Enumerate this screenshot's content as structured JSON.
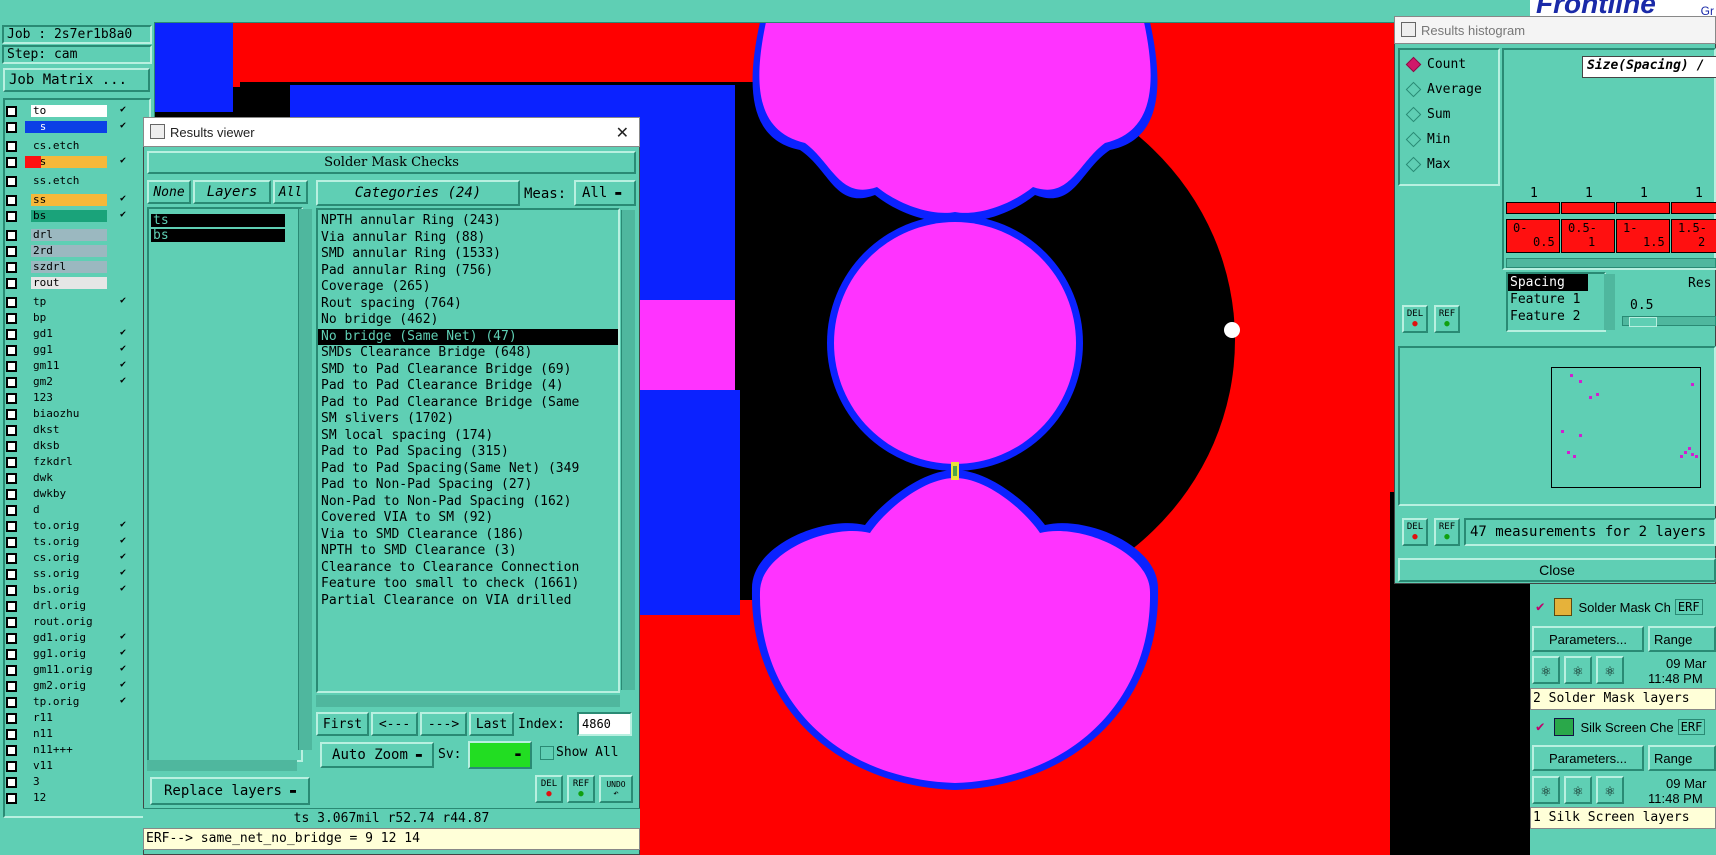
{
  "job": {
    "label": "Job : 2s7er1b8a0",
    "step": "Step: cam",
    "matrix_button": "Job Matrix ..."
  },
  "layers": [
    {
      "name": "to",
      "color": "#ffffff",
      "sel": false,
      "tick": "✔"
    },
    {
      "name": "ts",
      "color": "#0b3fe6",
      "sel": true,
      "tick": "✔"
    },
    {
      "name": "cs.etch",
      "color": "#5fcfb4",
      "tick": ""
    },
    {
      "name": "cs",
      "color": "#f5b83a",
      "red": true,
      "tick": "✔"
    },
    {
      "name": "ss.etch",
      "color": "#5fcfb4",
      "tick": ""
    },
    {
      "name": "ss",
      "color": "#f5b83a",
      "tick": "✔"
    },
    {
      "name": "bs",
      "color": "#1aa37a",
      "tick": "✔"
    },
    {
      "name": "drl",
      "color": "#9bb8c0",
      "tick": ""
    },
    {
      "name": "2rd",
      "color": "#9bb8c0",
      "tick": ""
    },
    {
      "name": "szdrl",
      "color": "#9bb8c0",
      "tick": ""
    },
    {
      "name": "rout",
      "color": "#e6e6e6",
      "tick": ""
    },
    {
      "name": "tp",
      "color": "#5fcfb4",
      "tick": "✔"
    },
    {
      "name": "bp",
      "color": "#5fcfb4",
      "tick": ""
    },
    {
      "name": "gd1",
      "color": "#5fcfb4",
      "tick": "✔"
    },
    {
      "name": "gg1",
      "color": "#5fcfb4",
      "tick": "✔"
    },
    {
      "name": "gm11",
      "color": "#5fcfb4",
      "tick": "✔"
    },
    {
      "name": "gm2",
      "color": "#5fcfb4",
      "tick": "✔"
    },
    {
      "name": "123",
      "color": "#5fcfb4",
      "tick": ""
    },
    {
      "name": "biaozhu",
      "color": "#5fcfb4",
      "tick": ""
    },
    {
      "name": "dkst",
      "color": "#5fcfb4",
      "tick": ""
    },
    {
      "name": "dksb",
      "color": "#5fcfb4",
      "tick": ""
    },
    {
      "name": "fzkdrl",
      "color": "#5fcfb4",
      "tick": ""
    },
    {
      "name": "dwk",
      "color": "#5fcfb4",
      "tick": ""
    },
    {
      "name": "dwkby",
      "color": "#5fcfb4",
      "tick": ""
    },
    {
      "name": "d",
      "color": "#5fcfb4",
      "tick": ""
    },
    {
      "name": "to.orig",
      "color": "#5fcfb4",
      "tick": "✔"
    },
    {
      "name": "ts.orig",
      "color": "#5fcfb4",
      "tick": "✔"
    },
    {
      "name": "cs.orig",
      "color": "#5fcfb4",
      "tick": "✔"
    },
    {
      "name": "ss.orig",
      "color": "#5fcfb4",
      "tick": "✔"
    },
    {
      "name": "bs.orig",
      "color": "#5fcfb4",
      "tick": "✔"
    },
    {
      "name": "drl.orig",
      "color": "#5fcfb4",
      "tick": ""
    },
    {
      "name": "rout.orig",
      "color": "#5fcfb4",
      "tick": ""
    },
    {
      "name": "gd1.orig",
      "color": "#5fcfb4",
      "tick": "✔"
    },
    {
      "name": "gg1.orig",
      "color": "#5fcfb4",
      "tick": "✔"
    },
    {
      "name": "gm11.orig",
      "color": "#5fcfb4",
      "tick": "✔"
    },
    {
      "name": "gm2.orig",
      "color": "#5fcfb4",
      "tick": "✔"
    },
    {
      "name": "tp.orig",
      "color": "#5fcfb4",
      "tick": "✔"
    },
    {
      "name": "r11",
      "color": "#5fcfb4",
      "tick": ""
    },
    {
      "name": "n11",
      "color": "#5fcfb4",
      "tick": ""
    },
    {
      "name": "n11+++",
      "color": "#5fcfb4",
      "tick": ""
    },
    {
      "name": "v11",
      "color": "#5fcfb4",
      "tick": ""
    },
    {
      "name": "3",
      "color": "#5fcfb4",
      "tick": ""
    },
    {
      "name": "12",
      "color": "#5fcfb4",
      "tick": ""
    }
  ],
  "viewer": {
    "title": "Results viewer",
    "close": "✕",
    "header": "Solder Mask Checks",
    "none": "None",
    "layers_btn": "Layers",
    "all": "All",
    "layer_items": [
      "ts",
      "bs"
    ],
    "categories_btn": "Categories (24)",
    "meas_label": "Meas:",
    "meas_value": "All",
    "categories": [
      "NPTH annular Ring (243)",
      "Via annular Ring (88)",
      "SMD annular Ring (1533)",
      "Pad annular Ring (756)",
      "Coverage (265)",
      "Rout spacing (764)",
      "No bridge (462)",
      "No bridge (Same Net) (47)",
      "SMDs Clearance Bridge (648)",
      "SMD to Pad Clearance Bridge (69)",
      "Pad to Pad Clearance Bridge (4)",
      "Pad to Pad Clearance Bridge (Same",
      "SM slivers (1702)",
      "SM local spacing (174)",
      "Pad to Pad Spacing (315)",
      "Pad to Pad Spacing(Same Net) (349",
      "Pad to Non-Pad Spacing (27)",
      "Non-Pad to Non-Pad Spacing (162)",
      "Covered VIA to SM (92)",
      "Via to SMD Clearance (186)",
      "NPTH to SMD Clearance (3)",
      "Clearance to Clearance Connection",
      "Feature too small to check (1661)",
      "Partial Clearance on VIA drilled"
    ],
    "selected_index": 7,
    "first": "First",
    "prev": "<---",
    "next": "--->",
    "last": "Last",
    "index_label": "Index:",
    "index_value": "4860",
    "auto_zoom": "Auto Zoom",
    "sv": "Sv:",
    "show_all": "Show All",
    "replace_layers": "Replace layers",
    "del": "DEL",
    "ref": "REF",
    "undo": "UNDO",
    "status": "ts 3.067mil  r52.74  r44.87",
    "erf_line": "ERF--> same_net_no_bridge = 9 12 14"
  },
  "histogram": {
    "title": "Results histogram",
    "radios": [
      "Count",
      "Average",
      "Sum",
      "Min",
      "Max"
    ],
    "radio_selected": 0,
    "size_label": "Size(Spacing) /",
    "counts": [
      "1",
      "1",
      "1",
      "1"
    ],
    "bins": [
      [
        "0-",
        "0.5"
      ],
      [
        "0.5-",
        "1"
      ],
      [
        "1-",
        "1.5"
      ],
      [
        "1.5-",
        "2"
      ]
    ],
    "list": [
      "Spacing",
      "Feature 1",
      "Feature 2"
    ],
    "res_label": "Res",
    "res_value": "0.5",
    "summary": "47 measurements for 2 layers",
    "close": "Close",
    "del": "DEL",
    "ref": "REF"
  },
  "erf_panel": {
    "solder": "Solder Mask Ch",
    "silk": "Silk Screen Che",
    "erf": "ERF",
    "params": "Parameters...",
    "range": "Range",
    "date": "09 Mar",
    "time": "11:48 PM",
    "solder_layers": "2 Solder Mask layers",
    "silk_layers": "1 Silk Screen layers"
  },
  "logo": "Frontline",
  "logo_sub": "Gr"
}
